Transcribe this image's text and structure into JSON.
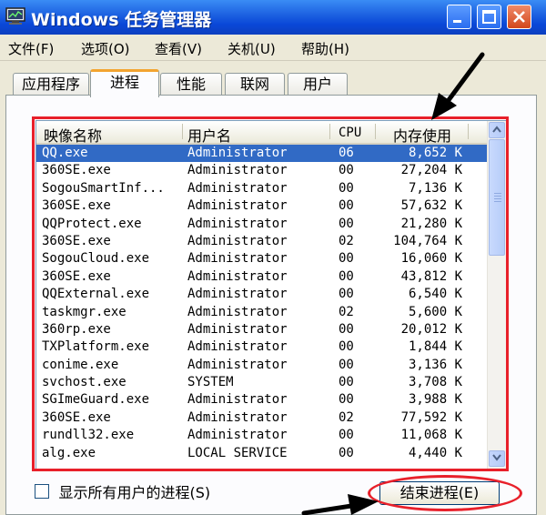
{
  "window": {
    "title": "Windows 任务管理器",
    "icon": "task-manager-icon",
    "controls": [
      "minimize-icon",
      "maximize-icon",
      "close-icon"
    ]
  },
  "menu": [
    "文件(F)",
    "选项(O)",
    "查看(V)",
    "关机(U)",
    "帮助(H)"
  ],
  "tabs": {
    "items": [
      "应用程序",
      "进程",
      "性能",
      "联网",
      "用户"
    ],
    "active": "进程"
  },
  "process_list": {
    "columns": [
      "映像名称",
      "用户名",
      "CPU",
      "内存使用"
    ],
    "rows": [
      {
        "name": "QQ.exe",
        "user": "Administrator",
        "cpu": "06",
        "mem": "8,652 K",
        "selected": true
      },
      {
        "name": "360SE.exe",
        "user": "Administrator",
        "cpu": "00",
        "mem": "27,204 K"
      },
      {
        "name": "SogouSmartInf...",
        "user": "Administrator",
        "cpu": "00",
        "mem": "7,136 K"
      },
      {
        "name": "360SE.exe",
        "user": "Administrator",
        "cpu": "00",
        "mem": "57,632 K"
      },
      {
        "name": "QQProtect.exe",
        "user": "Administrator",
        "cpu": "00",
        "mem": "21,280 K"
      },
      {
        "name": "360SE.exe",
        "user": "Administrator",
        "cpu": "02",
        "mem": "104,764 K"
      },
      {
        "name": "SogouCloud.exe",
        "user": "Administrator",
        "cpu": "00",
        "mem": "16,060 K"
      },
      {
        "name": "360SE.exe",
        "user": "Administrator",
        "cpu": "00",
        "mem": "43,812 K"
      },
      {
        "name": "QQExternal.exe",
        "user": "Administrator",
        "cpu": "00",
        "mem": "6,540 K"
      },
      {
        "name": "taskmgr.exe",
        "user": "Administrator",
        "cpu": "02",
        "mem": "5,600 K"
      },
      {
        "name": "360rp.exe",
        "user": "Administrator",
        "cpu": "00",
        "mem": "20,012 K"
      },
      {
        "name": "TXPlatform.exe",
        "user": "Administrator",
        "cpu": "00",
        "mem": "1,844 K"
      },
      {
        "name": "conime.exe",
        "user": "Administrator",
        "cpu": "00",
        "mem": "3,136 K"
      },
      {
        "name": "svchost.exe",
        "user": "SYSTEM",
        "cpu": "00",
        "mem": "3,708 K"
      },
      {
        "name": "SGImeGuard.exe",
        "user": "Administrator",
        "cpu": "00",
        "mem": "3,988 K"
      },
      {
        "name": "360SE.exe",
        "user": "Administrator",
        "cpu": "02",
        "mem": "77,592 K"
      },
      {
        "name": "rundll32.exe",
        "user": "Administrator",
        "cpu": "00",
        "mem": "11,068 K"
      },
      {
        "name": "alg.exe",
        "user": "LOCAL SERVICE",
        "cpu": "00",
        "mem": "4,440 K"
      }
    ]
  },
  "show_all_users": {
    "label": "显示所有用户的进程(S)",
    "checked": false
  },
  "end_process_button": {
    "label": "结束进程(E)"
  },
  "annotation_color": "#e8202a",
  "selection_color": "#316ac5"
}
